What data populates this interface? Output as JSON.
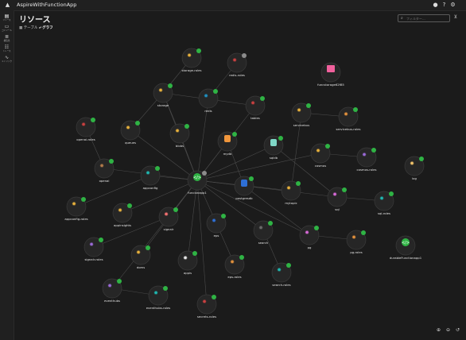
{
  "app": {
    "title": "AspireWithFunctionApp"
  },
  "top_icons": [
    "github-icon",
    "help-icon",
    "settings-icon"
  ],
  "sidebar": {
    "items": [
      {
        "label": "リソース",
        "icon": "resources-icon",
        "active": true
      },
      {
        "label": "コンソール",
        "icon": "console-icon",
        "active": false
      },
      {
        "label": "構造化",
        "icon": "structured-logs-icon",
        "active": false
      },
      {
        "label": "トレース",
        "icon": "traces-icon",
        "active": false
      },
      {
        "label": "メトリック",
        "icon": "metrics-icon",
        "active": false
      }
    ]
  },
  "page": {
    "title": "リソース"
  },
  "search": {
    "placeholder": "フィルター..."
  },
  "tabs": [
    {
      "label": "テーブル",
      "icon": "table-icon",
      "active": false
    },
    {
      "label": "グラフ",
      "icon": "graph-icon",
      "active": true
    }
  ],
  "colors": {
    "background": "#1b1b1b",
    "edge": "#4a4a4a",
    "status_running": "#2fb344",
    "status_unknown": "#8c8c8c"
  },
  "graph": {
    "nodes": [
      {
        "id": "storage-roles",
        "label": "storage-roles",
        "kind": "gear",
        "color": "#e6b03c",
        "status": "running"
      },
      {
        "id": "redis-roles",
        "label": "redis-roles",
        "kind": "gear",
        "color": "#c94040",
        "status": "unknown"
      },
      {
        "id": "funcstorage",
        "label": "funcstorage62f85",
        "kind": "box",
        "color": "#f0609c",
        "status": "none"
      },
      {
        "id": "storage",
        "label": "storage",
        "kind": "gear",
        "color": "#e6b03c",
        "status": "running"
      },
      {
        "id": "redis",
        "label": "redis",
        "kind": "gear",
        "color": "#1f8fbf",
        "status": "running"
      },
      {
        "id": "tables",
        "label": "tables",
        "kind": "gear",
        "color": "#c94040",
        "status": "running"
      },
      {
        "id": "servicebus",
        "label": "servicebus",
        "kind": "gear",
        "color": "#e6b03c",
        "status": "running"
      },
      {
        "id": "servicebus-roles",
        "label": "servicebus-roles",
        "kind": "gear",
        "color": "#e0903c",
        "status": "running"
      },
      {
        "id": "openai-roles",
        "label": "openai-roles",
        "kind": "gear",
        "color": "#c94040",
        "status": "running"
      },
      {
        "id": "queues",
        "label": "queues",
        "kind": "gear",
        "color": "#e6b03c",
        "status": "running"
      },
      {
        "id": "blobs",
        "label": "blobs",
        "kind": "gear",
        "color": "#e6b03c",
        "status": "running"
      },
      {
        "id": "mydb",
        "label": "mydb",
        "kind": "db",
        "color": "#f0963c",
        "status": "running"
      },
      {
        "id": "sqldb",
        "label": "sqldb",
        "kind": "db",
        "color": "#7fd6c6",
        "status": "running"
      },
      {
        "id": "cosmos",
        "label": "cosmos",
        "kind": "gear",
        "color": "#e6b03c",
        "status": "running"
      },
      {
        "id": "cosmos-roles",
        "label": "cosmos-roles",
        "kind": "gear",
        "color": "#9a6ad6",
        "status": "running"
      },
      {
        "id": "log",
        "label": "log",
        "kind": "gear",
        "color": "#f2c46a",
        "status": "running"
      },
      {
        "id": "openai",
        "label": "openai",
        "kind": "gear",
        "color": "#b07a4a",
        "status": "running"
      },
      {
        "id": "appconfig",
        "label": "appconfig",
        "kind": "gear",
        "color": "#1fb6b0",
        "status": "running"
      },
      {
        "id": "funcapp1",
        "label": "funcionapp1",
        "kind": "code",
        "color": "#2fb344",
        "status": "unknown"
      },
      {
        "id": "postgresdb",
        "label": "postgresdb",
        "kind": "db",
        "color": "#2e6fd6",
        "status": "running"
      },
      {
        "id": "mytopic",
        "label": "mytopic",
        "kind": "gear",
        "color": "#e6b03c",
        "status": "running"
      },
      {
        "id": "sql",
        "label": "sql",
        "kind": "gear",
        "color": "#d66ad6",
        "status": "running"
      },
      {
        "id": "sql-roles",
        "label": "sql-roles",
        "kind": "gear",
        "color": "#1fb6b0",
        "status": "running"
      },
      {
        "id": "appconfig-roles",
        "label": "appconfig-roles",
        "kind": "gear",
        "color": "#e6b03c",
        "status": "running"
      },
      {
        "id": "appinsights",
        "label": "appinsights",
        "kind": "gear",
        "color": "#e6b03c",
        "status": "running"
      },
      {
        "id": "signalr",
        "label": "signalr",
        "kind": "gear",
        "color": "#f07070",
        "status": "running"
      },
      {
        "id": "eps",
        "label": "eps",
        "kind": "gear",
        "color": "#2e6fd6",
        "status": "running"
      },
      {
        "id": "search",
        "label": "search",
        "kind": "gear",
        "color": "#6a6a6a",
        "status": "running"
      },
      {
        "id": "pg",
        "label": "pg",
        "kind": "gear",
        "color": "#d66ad6",
        "status": "running"
      },
      {
        "id": "pg-roles",
        "label": "pg-roles",
        "kind": "gear",
        "color": "#e0903c",
        "status": "running"
      },
      {
        "id": "durable",
        "label": "durableFunctionapp1",
        "kind": "code",
        "color": "#2fb344",
        "status": "none"
      },
      {
        "id": "signalr-roles",
        "label": "signalr-roles",
        "kind": "gear",
        "color": "#9a6ad6",
        "status": "running"
      },
      {
        "id": "doms",
        "label": "doms",
        "kind": "gear",
        "color": "#e6b03c",
        "status": "running"
      },
      {
        "id": "appis",
        "label": "appis",
        "kind": "gear",
        "color": "#e6e6e6",
        "status": "running"
      },
      {
        "id": "eps-roles",
        "label": "eps-roles",
        "kind": "gear",
        "color": "#e0903c",
        "status": "running"
      },
      {
        "id": "search-roles",
        "label": "search-roles",
        "kind": "gear",
        "color": "#1fb6b0",
        "status": "running"
      },
      {
        "id": "eventhubs",
        "label": "eventhubs",
        "kind": "gear",
        "color": "#9a6ad6",
        "status": "running"
      },
      {
        "id": "eventhubs-roles",
        "label": "eventhubs-roles",
        "kind": "gear",
        "color": "#1fb6b0",
        "status": "running"
      },
      {
        "id": "secrets-roles",
        "label": "secrets-roles",
        "kind": "gear",
        "color": "#c94040",
        "status": "running"
      }
    ],
    "edges": [
      [
        "funcapp1",
        "storage"
      ],
      [
        "funcapp1",
        "redis"
      ],
      [
        "funcapp1",
        "blobs"
      ],
      [
        "funcapp1",
        "queues"
      ],
      [
        "funcapp1",
        "mydb"
      ],
      [
        "funcapp1",
        "sqldb"
      ],
      [
        "funcapp1",
        "postgresdb"
      ],
      [
        "funcapp1",
        "appconfig"
      ],
      [
        "funcapp1",
        "openai"
      ],
      [
        "funcapp1",
        "appinsights"
      ],
      [
        "funcapp1",
        "signalr"
      ],
      [
        "funcapp1",
        "eps"
      ],
      [
        "funcapp1",
        "search"
      ],
      [
        "funcapp1",
        "pg"
      ],
      [
        "funcapp1",
        "mytopic"
      ],
      [
        "funcapp1",
        "sql"
      ],
      [
        "funcapp1",
        "cosmos"
      ],
      [
        "funcapp1",
        "doms"
      ],
      [
        "funcapp1",
        "appis"
      ],
      [
        "funcapp1",
        "eventhubs"
      ],
      [
        "funcapp1",
        "secrets-roles"
      ],
      [
        "funcapp1",
        "tables"
      ],
      [
        "storage",
        "storage-roles"
      ],
      [
        "redis",
        "redis-roles"
      ],
      [
        "storage",
        "blobs"
      ],
      [
        "storage",
        "queues"
      ],
      [
        "storage",
        "tables"
      ],
      [
        "servicebus",
        "servicebus-roles"
      ],
      [
        "servicebus",
        "mytopic"
      ],
      [
        "openai",
        "openai-roles"
      ],
      [
        "cosmos",
        "cosmos-roles"
      ],
      [
        "sqldb",
        "sql"
      ],
      [
        "sql",
        "sql-roles"
      ],
      [
        "appconfig",
        "appconfig-roles"
      ],
      [
        "signalr",
        "signalr-roles"
      ],
      [
        "eps",
        "eps-roles"
      ],
      [
        "search",
        "search-roles"
      ],
      [
        "pg",
        "pg-roles"
      ],
      [
        "eventhubs",
        "eventhubs-roles"
      ],
      [
        "postgresdb",
        "pg"
      ],
      [
        "mydb",
        "postgresdb"
      ]
    ]
  }
}
